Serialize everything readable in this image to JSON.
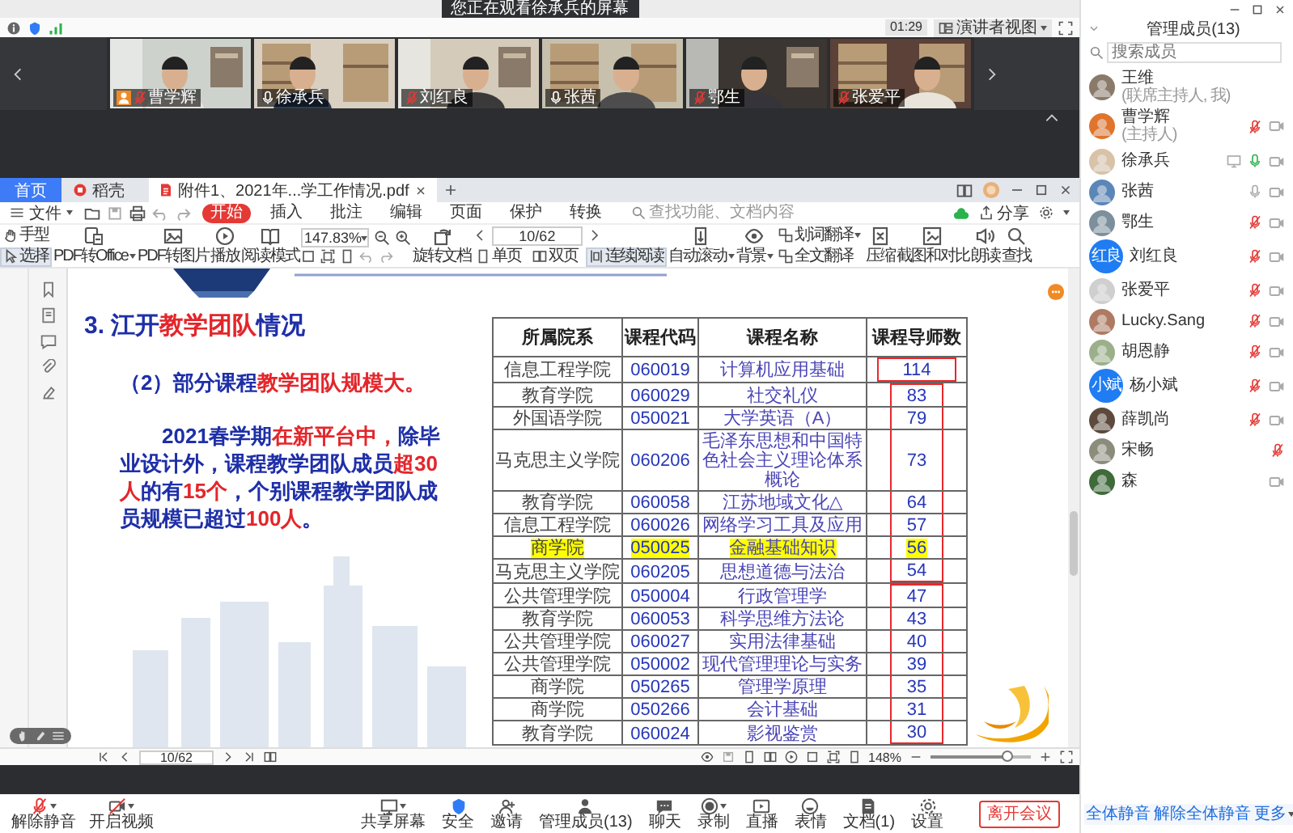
{
  "meeting": {
    "notice": "您正在观看徐承兵的屏幕",
    "timer": "01:29",
    "view_button": "演讲者视图"
  },
  "video_tiles": [
    {
      "name": "曹学辉",
      "muted": true,
      "host": true
    },
    {
      "name": "徐承兵",
      "muted": false,
      "host": false
    },
    {
      "name": "刘红良",
      "muted": true,
      "host": false
    },
    {
      "name": "张茜",
      "muted": false,
      "host": false
    },
    {
      "name": "鄂生",
      "muted": true,
      "host": false
    },
    {
      "name": "张爱平",
      "muted": true,
      "host": false
    }
  ],
  "pdf_app": {
    "tabs": [
      {
        "label": "首页",
        "kind": "home",
        "selected": false
      },
      {
        "label": "稻壳",
        "kind": "store",
        "selected": false
      },
      {
        "label": "附件1、2021年...学工作情况.pdf",
        "kind": "file",
        "selected": true
      }
    ],
    "menu": {
      "file": "文件",
      "items": [
        {
          "label": "开始",
          "selected": true
        },
        {
          "label": "插入",
          "selected": false
        },
        {
          "label": "批注",
          "selected": false
        },
        {
          "label": "编辑",
          "selected": false
        },
        {
          "label": "页面",
          "selected": false
        },
        {
          "label": "保护",
          "selected": false
        },
        {
          "label": "转换",
          "selected": false
        }
      ],
      "search_placeholder": "查找功能、文档内容",
      "share": "分享"
    },
    "toolbar": [
      {
        "kind": "tools",
        "items": [
          {
            "label": "手型",
            "selected": false
          },
          {
            "label": "选择",
            "selected": true
          }
        ]
      },
      {
        "kind": "button",
        "label": "PDF转Office",
        "dropdown": true
      },
      {
        "kind": "button",
        "label": "PDF转图片",
        "dropdown": false
      },
      {
        "kind": "button",
        "label": "播放",
        "dropdown": false
      },
      {
        "kind": "button",
        "label": "阅读模式",
        "dropdown": false
      },
      {
        "kind": "zoom",
        "value": "147.83%"
      },
      {
        "kind": "button",
        "label": "旋转文档",
        "dropdown": false
      },
      {
        "kind": "pager",
        "value": "10/62",
        "modes": [
          {
            "label": "单页",
            "selected": false
          },
          {
            "label": "双页",
            "selected": false
          },
          {
            "label": "连续阅读",
            "selected": true
          }
        ]
      },
      {
        "kind": "button",
        "label": "自动滚动",
        "dropdown": true
      },
      {
        "kind": "button",
        "label": "背景",
        "dropdown": true
      },
      {
        "kind": "pair",
        "items": [
          {
            "label": "划词翻译",
            "dropdown": true
          },
          {
            "label": "全文翻译",
            "dropdown": false
          }
        ]
      },
      {
        "kind": "button",
        "label": "压缩",
        "dropdown": false
      },
      {
        "kind": "button",
        "label": "截图和对比",
        "dropdown": false
      },
      {
        "kind": "button",
        "label": "朗读",
        "dropdown": false
      },
      {
        "kind": "button",
        "label": "查找",
        "dropdown": false
      }
    ],
    "document": {
      "title": [
        {
          "text": "3. 江开",
          "emphasis": false
        },
        {
          "text": "教学团队",
          "emphasis": true
        },
        {
          "text": "情况",
          "emphasis": false
        }
      ],
      "subtitle": [
        {
          "text": "（2）部分课程",
          "emphasis": false
        },
        {
          "text": "教学团队规模大。",
          "emphasis": true
        }
      ],
      "paragraph": [
        {
          "text": "2021春学期",
          "emphasis": false
        },
        {
          "text": "在新平台中，",
          "emphasis": true
        },
        {
          "text": "除毕业设计外，课程教学团队成员",
          "emphasis": false
        },
        {
          "text": "超30人",
          "emphasis": true
        },
        {
          "text": "的有",
          "emphasis": false
        },
        {
          "text": "15个",
          "emphasis": true
        },
        {
          "text": "，个别课程教学团队成员规模已超过",
          "emphasis": false
        },
        {
          "text": "100人",
          "emphasis": true
        },
        {
          "text": "。",
          "emphasis": false
        }
      ],
      "table": {
        "columns": [
          "所属院系",
          "课程代码",
          "课程名称",
          "课程导师数"
        ],
        "rows": [
          {
            "cells": [
              "信息工程学院",
              "060019",
              "计算机应用基础",
              "114"
            ],
            "highlight": false,
            "frame_start": true,
            "frame_end": true
          },
          {
            "cells": [
              "教育学院",
              "060029",
              "社交礼仪",
              "83"
            ],
            "highlight": false,
            "frame_start": true,
            "frame_end": false
          },
          {
            "cells": [
              "外国语学院",
              "050021",
              "大学英语（A）",
              "79"
            ],
            "highlight": false,
            "frame_start": false,
            "frame_end": false
          },
          {
            "cells": [
              "马克思主义学院",
              "060206",
              "毛泽东思想和中国特色社会主义理论体系概论",
              "73"
            ],
            "highlight": false,
            "frame_start": false,
            "frame_end": false
          },
          {
            "cells": [
              "教育学院",
              "060058",
              "江苏地域文化△",
              "64"
            ],
            "highlight": false,
            "frame_start": false,
            "frame_end": false
          },
          {
            "cells": [
              "信息工程学院",
              "060026",
              "网络学习工具及应用",
              "57"
            ],
            "highlight": false,
            "frame_start": false,
            "frame_end": false
          },
          {
            "cells": [
              "商学院",
              "050025",
              "金融基础知识",
              "56"
            ],
            "highlight": true,
            "frame_start": false,
            "frame_end": false
          },
          {
            "cells": [
              "马克思主义学院",
              "060205",
              "思想道德与法治",
              "54"
            ],
            "highlight": false,
            "frame_start": false,
            "frame_end": true
          },
          {
            "cells": [
              "公共管理学院",
              "050004",
              "行政管理学",
              "47"
            ],
            "highlight": false,
            "frame_start": true,
            "frame_end": false
          },
          {
            "cells": [
              "教育学院",
              "060053",
              "科学思维方法论",
              "43"
            ],
            "highlight": false,
            "frame_start": false,
            "frame_end": false
          },
          {
            "cells": [
              "公共管理学院",
              "060027",
              "实用法律基础",
              "40"
            ],
            "highlight": false,
            "frame_start": false,
            "frame_end": false
          },
          {
            "cells": [
              "公共管理学院",
              "050002",
              "现代管理理论与实务",
              "39"
            ],
            "highlight": false,
            "frame_start": false,
            "frame_end": false
          },
          {
            "cells": [
              "商学院",
              "050265",
              "管理学原理",
              "35"
            ],
            "highlight": false,
            "frame_start": false,
            "frame_end": false
          },
          {
            "cells": [
              "商学院",
              "050266",
              "会计基础",
              "31"
            ],
            "highlight": false,
            "frame_start": false,
            "frame_end": false
          },
          {
            "cells": [
              "教育学院",
              "060024",
              "影视鉴赏",
              "30"
            ],
            "highlight": false,
            "frame_start": false,
            "frame_end": true
          }
        ]
      }
    },
    "status_bar": {
      "page": "10/62",
      "zoom": "148%",
      "zoom_slider": {
        "level": 0.75
      }
    }
  },
  "participants": {
    "title": "管理成员(13)",
    "search_placeholder": "搜索成员",
    "members": [
      {
        "name": "王维",
        "role": "(联席主持人, 我)",
        "camera": false,
        "sharing": false
      },
      {
        "name": "曹学辉",
        "role": "(主持人)",
        "muted": true,
        "talking": false,
        "camera": true,
        "sharing": false
      },
      {
        "name": "徐承兵",
        "muted": false,
        "talking": true,
        "camera": true,
        "sharing": true
      },
      {
        "name": "张茜",
        "muted": false,
        "talking": false,
        "camera": true,
        "sharing": false
      },
      {
        "name": "鄂生",
        "muted": true,
        "talking": false,
        "camera": true,
        "sharing": false
      },
      {
        "name": "刘红良",
        "avatar_text": "红良",
        "muted": true,
        "talking": false,
        "camera": true,
        "sharing": false
      },
      {
        "name": "张爱平",
        "muted": true,
        "talking": false,
        "camera": true,
        "sharing": false
      },
      {
        "name": "Lucky.Sang",
        "muted": true,
        "talking": false,
        "camera": true,
        "sharing": false
      },
      {
        "name": "胡恩静",
        "muted": true,
        "talking": false,
        "camera": true,
        "sharing": false
      },
      {
        "name": "杨小斌",
        "avatar_text": "小斌",
        "muted": true,
        "talking": false,
        "camera": true,
        "sharing": false
      },
      {
        "name": "薛凯尚",
        "muted": true,
        "talking": false,
        "camera": true,
        "sharing": false
      },
      {
        "name": "宋畅",
        "muted": true,
        "talking": false,
        "camera": false,
        "sharing": false
      },
      {
        "name": "森",
        "camera": true,
        "sharing": false
      }
    ],
    "buttons": [
      {
        "label": "全体静音",
        "dropdown": false
      },
      {
        "label": "解除全体静音",
        "dropdown": false
      },
      {
        "label": "更多",
        "dropdown": true
      }
    ]
  },
  "controls": {
    "left": [
      {
        "label": "解除静音",
        "dropdown": true
      },
      {
        "label": "开启视频",
        "dropdown": true
      }
    ],
    "center": [
      {
        "label": "共享屏幕",
        "dropdown": true
      },
      {
        "label": "安全",
        "dropdown": false
      },
      {
        "label": "邀请",
        "dropdown": false
      },
      {
        "label": "管理成员(13)",
        "dropdown": false
      },
      {
        "label": "聊天",
        "dropdown": false
      },
      {
        "label": "录制",
        "dropdown": true
      },
      {
        "label": "直播",
        "dropdown": false
      },
      {
        "label": "表情",
        "dropdown": false
      },
      {
        "label": "文档(1)",
        "dropdown": false
      },
      {
        "label": "设置",
        "dropdown": false
      }
    ],
    "leave": "离开会议"
  }
}
